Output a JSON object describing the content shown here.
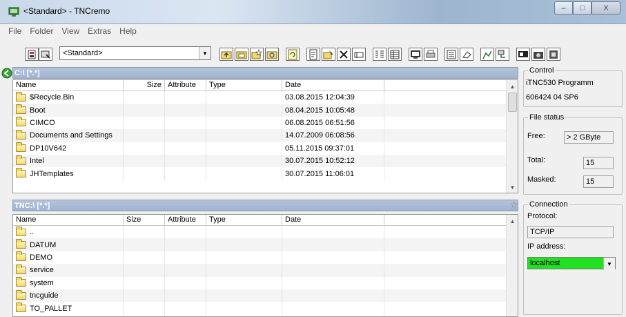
{
  "window": {
    "title": "<Standard> - TNCremo",
    "minimize": "–",
    "maximize": "□",
    "close": "X"
  },
  "menu": [
    "File",
    "Folder",
    "View",
    "Extras",
    "Help"
  ],
  "toolbar": {
    "profile_value": "<Standard>",
    "icons": [
      "connection-icon",
      "settings-icon",
      "folder-up-icon",
      "new-folder-icon",
      "open-folder-icon",
      "search-icon",
      "refresh-icon",
      "edit-file-icon",
      "copy-icon",
      "delete-icon",
      "rename-icon",
      "list-view-icon",
      "detail-view-icon",
      "screen-icon",
      "print-icon",
      "explorer-icon",
      "eraser-icon",
      "chart-icon",
      "network-icon",
      "monitor-icon",
      "camera-icon",
      "machine-icon"
    ]
  },
  "pc_pane": {
    "path": "C:\\ [*.*]",
    "columns": [
      "Name",
      "Size",
      "Attribute",
      "Type",
      "Date"
    ],
    "rows": [
      {
        "name": "$Recycle.Bin",
        "size": "",
        "attr": "",
        "type": "",
        "date": "03.08.2015 12:04:39"
      },
      {
        "name": "Boot",
        "size": "",
        "attr": "",
        "type": "",
        "date": "08.04.2015 10:05:48"
      },
      {
        "name": "CIMCO",
        "size": "",
        "attr": "",
        "type": "",
        "date": "06.08.2015 06:51:56"
      },
      {
        "name": "Documents and Settings",
        "size": "",
        "attr": "",
        "type": "",
        "date": "14.07.2009 06:08:56"
      },
      {
        "name": "DP10V642",
        "size": "",
        "attr": "",
        "type": "",
        "date": "05.11.2015 09:37:01"
      },
      {
        "name": "Intel",
        "size": "",
        "attr": "",
        "type": "",
        "date": "30.07.2015 10:52:12"
      },
      {
        "name": "JHTemplates",
        "size": "",
        "attr": "",
        "type": "",
        "date": "30.07.2015 11:06:01"
      }
    ]
  },
  "tnc_pane": {
    "path": "TNC:\\ [*.*]",
    "columns": [
      "Name",
      "Size",
      "Attribute",
      "Type",
      "Date"
    ],
    "rows": [
      {
        "name": "..",
        "size": "",
        "attr": "",
        "type": "",
        "date": ""
      },
      {
        "name": "DATUM",
        "size": "",
        "attr": "",
        "type": "",
        "date": ""
      },
      {
        "name": "DEMO",
        "size": "",
        "attr": "",
        "type": "",
        "date": ""
      },
      {
        "name": "service",
        "size": "",
        "attr": "",
        "type": "",
        "date": ""
      },
      {
        "name": "system",
        "size": "",
        "attr": "",
        "type": "",
        "date": ""
      },
      {
        "name": "tncguide",
        "size": "",
        "attr": "",
        "type": "",
        "date": ""
      },
      {
        "name": "TO_PALLET",
        "size": "",
        "attr": "",
        "type": "",
        "date": ""
      }
    ]
  },
  "control": {
    "legend": "Control",
    "line1": "iTNC530 Programm",
    "line2": "606424 04 SP6"
  },
  "file_status": {
    "legend": "File status",
    "free_label": "Free:",
    "free_value": "> 2 GByte",
    "total_label": "Total:",
    "total_value": "15",
    "masked_label": "Masked:",
    "masked_value": "15"
  },
  "connection": {
    "legend": "Connection",
    "protocol_label": "Protocol:",
    "protocol_value": "TCP/IP",
    "ip_label": "IP address:",
    "ip_value": "localhost"
  },
  "colors": {
    "ip_highlight": "#22e022",
    "pane_header": "#a0b4cf"
  }
}
